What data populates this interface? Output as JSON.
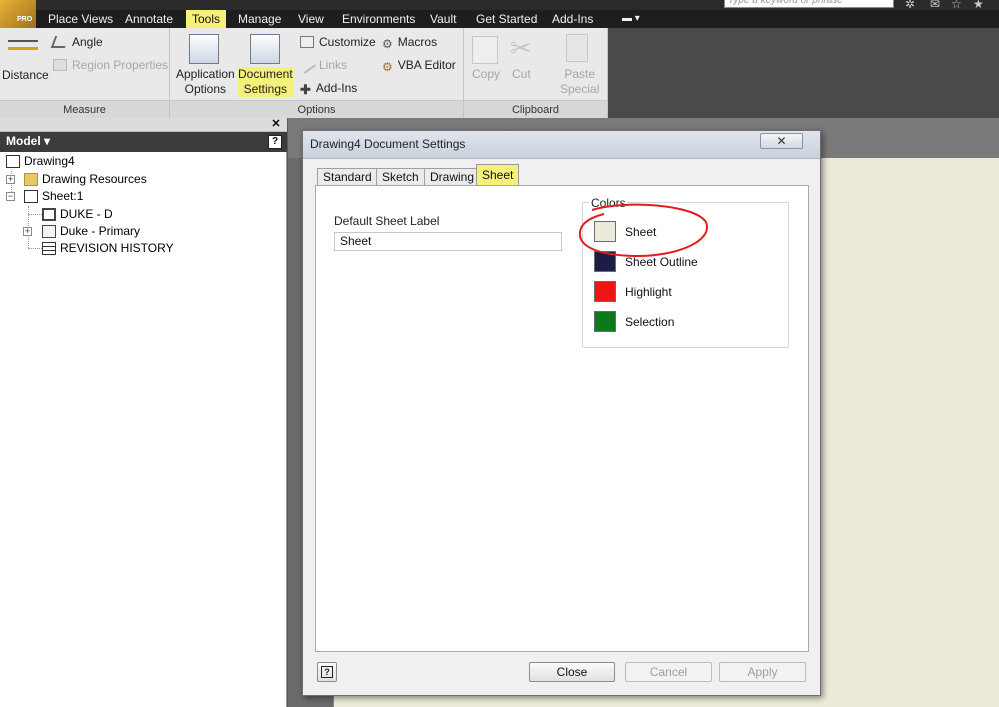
{
  "app": {
    "badge": "PRO"
  },
  "search": {
    "placeholder": "Type a keyword or phrase"
  },
  "menu_tabs": [
    "Place Views",
    "Annotate",
    "Tools",
    "Manage",
    "View",
    "Environments",
    "Vault",
    "Get Started",
    "Add-Ins"
  ],
  "active_tab": "Tools",
  "ribbon": {
    "measure": {
      "title": "Measure",
      "distance": "Distance",
      "angle": "Angle",
      "region_properties": "Region Properties"
    },
    "options": {
      "title": "Options",
      "application_options": [
        "Application",
        "Options"
      ],
      "document_settings": [
        "Document",
        "Settings"
      ],
      "customize": "Customize",
      "links": "Links",
      "add_ins": "Add-Ins",
      "macros": "Macros",
      "vba_editor": "VBA Editor"
    },
    "clipboard": {
      "title": "Clipboard",
      "copy": "Copy",
      "cut": "Cut",
      "paste_special": [
        "Paste",
        "Special"
      ]
    }
  },
  "browser": {
    "title": "Model",
    "help": "?",
    "tree": [
      {
        "label": "Drawing4"
      },
      {
        "label": "Drawing Resources"
      },
      {
        "label": "Sheet:1"
      },
      {
        "label": "DUKE - D"
      },
      {
        "label": "Duke - Primary"
      },
      {
        "label": "REVISION HISTORY"
      }
    ]
  },
  "dialog": {
    "title": "Drawing4 Document Settings",
    "close_glyph": "✕",
    "tabs": [
      "Standard",
      "Sketch",
      "Drawing",
      "Sheet"
    ],
    "selected_tab": "Sheet",
    "default_sheet_label": {
      "label": "Default Sheet Label",
      "value": "Sheet"
    },
    "colors": {
      "legend": "Colors",
      "items": [
        {
          "label": "Sheet",
          "color": "#ecebdb"
        },
        {
          "label": "Sheet Outline",
          "color": "#1b1d46"
        },
        {
          "label": "Highlight",
          "color": "#f01414"
        },
        {
          "label": "Selection",
          "color": "#0a7a1a"
        }
      ]
    },
    "buttons": {
      "help": "?",
      "close": "Close",
      "cancel": "Cancel",
      "apply": "Apply"
    }
  }
}
